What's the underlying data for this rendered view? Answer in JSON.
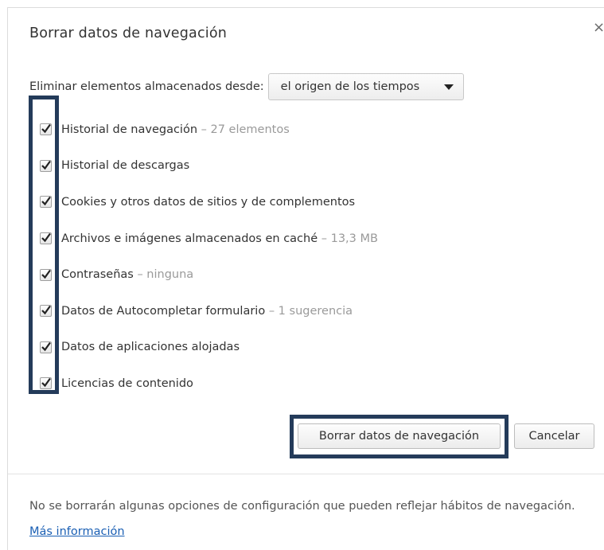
{
  "dialog": {
    "title": "Borrar datos de navegación",
    "close_symbol": "×"
  },
  "range": {
    "label": "Eliminar elementos almacenados desde:",
    "selected": "el origen de los tiempos"
  },
  "items": [
    {
      "label": "Historial de navegación",
      "detail": "– 27 elementos",
      "checked": true
    },
    {
      "label": "Historial de descargas",
      "detail": "",
      "checked": true
    },
    {
      "label": "Cookies y otros datos de sitios y de complementos",
      "detail": "",
      "checked": true
    },
    {
      "label": "Archivos e imágenes almacenados en caché",
      "detail": "– 13,3 MB",
      "checked": true
    },
    {
      "label": "Contraseñas",
      "detail": "– ninguna",
      "checked": true
    },
    {
      "label": "Datos de Autocompletar formulario",
      "detail": "– 1 sugerencia",
      "checked": true
    },
    {
      "label": "Datos de aplicaciones alojadas",
      "detail": "",
      "checked": true
    },
    {
      "label": "Licencias de contenido",
      "detail": "",
      "checked": true
    }
  ],
  "buttons": {
    "clear": "Borrar datos de navegación",
    "cancel": "Cancelar"
  },
  "footer": {
    "text": "No se borrarán algunas opciones de configuración que pueden reflejar hábitos de navegación.",
    "link": "Más información"
  },
  "colors": {
    "highlight_border": "#243b5a",
    "link": "#1a5fb4",
    "detail_text": "#9a9a9a"
  }
}
